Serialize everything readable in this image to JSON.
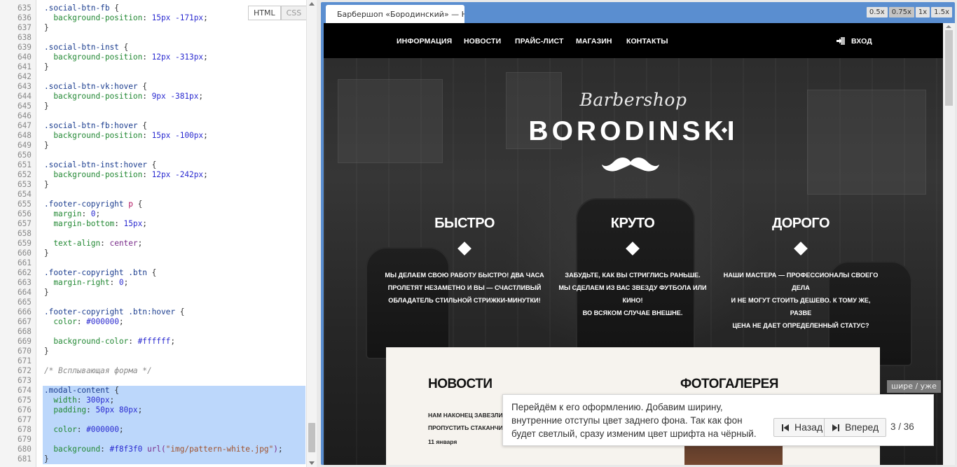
{
  "editor": {
    "modes": [
      "HTML",
      "CSS"
    ],
    "lines": [
      {
        "n": "635",
        "parts": [
          [
            "tk-sel",
            ".social-btn-fb "
          ],
          [
            "tk-p",
            "{"
          ]
        ]
      },
      {
        "n": "636",
        "parts": [
          [
            "tk-p",
            "  "
          ],
          [
            "tk-prop",
            "background-position"
          ],
          [
            "tk-p",
            ": "
          ],
          [
            "tk-num",
            "15px -171px"
          ],
          [
            "tk-p",
            ";"
          ]
        ]
      },
      {
        "n": "637",
        "parts": [
          [
            "tk-p",
            "}"
          ]
        ]
      },
      {
        "n": "638",
        "parts": []
      },
      {
        "n": "639",
        "parts": [
          [
            "tk-sel",
            ".social-btn-inst "
          ],
          [
            "tk-p",
            "{"
          ]
        ]
      },
      {
        "n": "640",
        "parts": [
          [
            "tk-p",
            "  "
          ],
          [
            "tk-prop",
            "background-position"
          ],
          [
            "tk-p",
            ": "
          ],
          [
            "tk-num",
            "12px -313px"
          ],
          [
            "tk-p",
            ";"
          ]
        ]
      },
      {
        "n": "641",
        "parts": [
          [
            "tk-p",
            "}"
          ]
        ]
      },
      {
        "n": "642",
        "parts": []
      },
      {
        "n": "643",
        "parts": [
          [
            "tk-sel",
            ".social-btn-vk:hover "
          ],
          [
            "tk-p",
            "{"
          ]
        ]
      },
      {
        "n": "644",
        "parts": [
          [
            "tk-p",
            "  "
          ],
          [
            "tk-prop",
            "background-position"
          ],
          [
            "tk-p",
            ": "
          ],
          [
            "tk-num",
            "9px -381px"
          ],
          [
            "tk-p",
            ";"
          ]
        ]
      },
      {
        "n": "645",
        "parts": [
          [
            "tk-p",
            "}"
          ]
        ]
      },
      {
        "n": "646",
        "parts": []
      },
      {
        "n": "647",
        "parts": [
          [
            "tk-sel",
            ".social-btn-fb:hover "
          ],
          [
            "tk-p",
            "{"
          ]
        ]
      },
      {
        "n": "648",
        "parts": [
          [
            "tk-p",
            "  "
          ],
          [
            "tk-prop",
            "background-position"
          ],
          [
            "tk-p",
            ": "
          ],
          [
            "tk-num",
            "15px -100px"
          ],
          [
            "tk-p",
            ";"
          ]
        ]
      },
      {
        "n": "649",
        "parts": [
          [
            "tk-p",
            "}"
          ]
        ]
      },
      {
        "n": "650",
        "parts": []
      },
      {
        "n": "651",
        "parts": [
          [
            "tk-sel",
            ".social-btn-inst:hover "
          ],
          [
            "tk-p",
            "{"
          ]
        ]
      },
      {
        "n": "652",
        "parts": [
          [
            "tk-p",
            "  "
          ],
          [
            "tk-prop",
            "background-position"
          ],
          [
            "tk-p",
            ": "
          ],
          [
            "tk-num",
            "12px -242px"
          ],
          [
            "tk-p",
            ";"
          ]
        ]
      },
      {
        "n": "653",
        "parts": [
          [
            "tk-p",
            "}"
          ]
        ]
      },
      {
        "n": "654",
        "parts": []
      },
      {
        "n": "655",
        "parts": [
          [
            "tk-sel",
            ".footer-copyright "
          ],
          [
            "tk-tag",
            "p"
          ],
          [
            "tk-p",
            " {"
          ]
        ]
      },
      {
        "n": "656",
        "parts": [
          [
            "tk-p",
            "  "
          ],
          [
            "tk-prop",
            "margin"
          ],
          [
            "tk-p",
            ": "
          ],
          [
            "tk-num",
            "0"
          ],
          [
            "tk-p",
            ";"
          ]
        ]
      },
      {
        "n": "657",
        "parts": [
          [
            "tk-p",
            "  "
          ],
          [
            "tk-prop",
            "margin-bottom"
          ],
          [
            "tk-p",
            ": "
          ],
          [
            "tk-num",
            "15px"
          ],
          [
            "tk-p",
            ";"
          ]
        ]
      },
      {
        "n": "658",
        "parts": []
      },
      {
        "n": "659",
        "parts": [
          [
            "tk-p",
            "  "
          ],
          [
            "tk-prop",
            "text-align"
          ],
          [
            "tk-p",
            ": "
          ],
          [
            "tk-kw",
            "center"
          ],
          [
            "tk-p",
            ";"
          ]
        ]
      },
      {
        "n": "660",
        "parts": [
          [
            "tk-p",
            "}"
          ]
        ]
      },
      {
        "n": "661",
        "parts": []
      },
      {
        "n": "662",
        "parts": [
          [
            "tk-sel",
            ".footer-copyright .btn "
          ],
          [
            "tk-p",
            "{"
          ]
        ]
      },
      {
        "n": "663",
        "parts": [
          [
            "tk-p",
            "  "
          ],
          [
            "tk-prop",
            "margin-right"
          ],
          [
            "tk-p",
            ": "
          ],
          [
            "tk-num",
            "0"
          ],
          [
            "tk-p",
            ";"
          ]
        ]
      },
      {
        "n": "664",
        "parts": [
          [
            "tk-p",
            "}"
          ]
        ]
      },
      {
        "n": "665",
        "parts": []
      },
      {
        "n": "666",
        "parts": [
          [
            "tk-sel",
            ".footer-copyright .btn:hover "
          ],
          [
            "tk-p",
            "{"
          ]
        ]
      },
      {
        "n": "667",
        "parts": [
          [
            "tk-p",
            "  "
          ],
          [
            "tk-prop",
            "color"
          ],
          [
            "tk-p",
            ": "
          ],
          [
            "tk-num",
            "#000000"
          ],
          [
            "tk-p",
            ";"
          ]
        ]
      },
      {
        "n": "668",
        "parts": []
      },
      {
        "n": "669",
        "parts": [
          [
            "tk-p",
            "  "
          ],
          [
            "tk-prop",
            "background-color"
          ],
          [
            "tk-p",
            ": "
          ],
          [
            "tk-num",
            "#ffffff"
          ],
          [
            "tk-p",
            ";"
          ]
        ]
      },
      {
        "n": "670",
        "parts": [
          [
            "tk-p",
            "}"
          ]
        ]
      },
      {
        "n": "671",
        "parts": []
      },
      {
        "n": "672",
        "parts": [
          [
            "tk-com",
            "/* Всплывающая форма */"
          ]
        ]
      },
      {
        "n": "673",
        "parts": []
      },
      {
        "n": "674",
        "sel": true,
        "parts": [
          [
            "tk-sel",
            ".modal-content "
          ],
          [
            "tk-p",
            "{"
          ]
        ]
      },
      {
        "n": "675",
        "sel": true,
        "parts": [
          [
            "tk-p",
            "  "
          ],
          [
            "tk-prop",
            "width"
          ],
          [
            "tk-p",
            ": "
          ],
          [
            "tk-num",
            "300px"
          ],
          [
            "tk-p",
            ";"
          ]
        ]
      },
      {
        "n": "676",
        "sel": true,
        "parts": [
          [
            "tk-p",
            "  "
          ],
          [
            "tk-prop",
            "padding"
          ],
          [
            "tk-p",
            ": "
          ],
          [
            "tk-num",
            "50px 80px"
          ],
          [
            "tk-p",
            ";"
          ]
        ]
      },
      {
        "n": "677",
        "sel": true,
        "parts": []
      },
      {
        "n": "678",
        "sel": true,
        "parts": [
          [
            "tk-p",
            "  "
          ],
          [
            "tk-prop",
            "color"
          ],
          [
            "tk-p",
            ": "
          ],
          [
            "tk-num",
            "#000000"
          ],
          [
            "tk-p",
            ";"
          ]
        ]
      },
      {
        "n": "679",
        "sel": true,
        "parts": []
      },
      {
        "n": "680",
        "sel": true,
        "parts": [
          [
            "tk-p",
            "  "
          ],
          [
            "tk-prop",
            "background"
          ],
          [
            "tk-p",
            ": "
          ],
          [
            "tk-num",
            "#f8f3f0 "
          ],
          [
            "tk-kw",
            "url("
          ],
          [
            "tk-str",
            "\"img/pattern-white.jpg\""
          ],
          [
            "tk-kw",
            ")"
          ],
          [
            "tk-p",
            ";"
          ]
        ]
      },
      {
        "n": "681",
        "sel": true,
        "parts": [
          [
            "tk-p",
            "}"
          ]
        ]
      }
    ]
  },
  "preview": {
    "tab_title": "Барбершоп «Бородинский» — HTML",
    "zoom": [
      "0.5x",
      "0.75x",
      "1x",
      "1.5x"
    ],
    "zoom_current": "0.75x",
    "nav": [
      "ИНФОРМАЦИЯ",
      "НОВОСТИ",
      "ПРАЙС-ЛИСТ",
      "МАГАЗИН",
      "КОНТАКТЫ"
    ],
    "login": "ВХОД",
    "brand_script": "Barbershop",
    "brand_main": "BORODINSKI",
    "features": [
      {
        "title": "БЫСТРО",
        "text": [
          "МЫ ДЕЛАЕМ СВОЮ РАБОТУ БЫСТРО! ДВА ЧАСА",
          "ПРОЛЕТЯТ НЕЗАМЕТНО И ВЫ — СЧАСТЛИВЫЙ",
          "ОБЛАДАТЕЛЬ СТИЛЬНОЙ СТРИЖКИ-МИНУТКИ!"
        ]
      },
      {
        "title": "КРУТО",
        "text": [
          "ЗАБУДЬТЕ, КАК ВЫ СТРИГЛИСЬ РАНЬШЕ.",
          "МЫ СДЕЛАЕМ ИЗ ВАС ЗВЕЗДУ ФУТБОЛА ИЛИ КИНО!",
          "ВО ВСЯКОМ СЛУЧАЕ ВНЕШНЕ."
        ]
      },
      {
        "title": "ДОРОГО",
        "text": [
          "НАШИ МАСТЕРА — ПРОФЕССИОНАЛЫ СВОЕГО ДЕЛА",
          "И НЕ МОГУТ СТОИТЬ ДЕШЕВО. К ТОМУ ЖЕ, РАЗВЕ",
          "ЦЕНА НЕ ДАЕТ ОПРЕДЕЛЕННЫЙ СТАТУС?"
        ]
      }
    ],
    "news_title": "НОВОСТИ",
    "gallery_title": "ФОТОГАЛЕРЕЯ",
    "news_lines": [
      "НАМ НАКОНЕЦ ЗАВЕЗЛИ ЯГ",
      "ПРОПУСТИТЬ СТАКАНЧИК В"
    ],
    "news_date": "11 января",
    "wider_narrower": "шире / уже"
  },
  "tour": {
    "text": "Перейдём к его оформлению. Добавим ширину, внутренние отступы цвет заднего фона. Так как фон будет светлый, сразу изменим цвет шрифта на чёрный.",
    "back": "Назад",
    "forward": "Вперед",
    "step": "3 / 36"
  },
  "colors": {
    "preview_frame": "#5a8ed0",
    "selection": "#bcd7fb",
    "nav": "#000000",
    "panel": "#f6f3ee"
  }
}
